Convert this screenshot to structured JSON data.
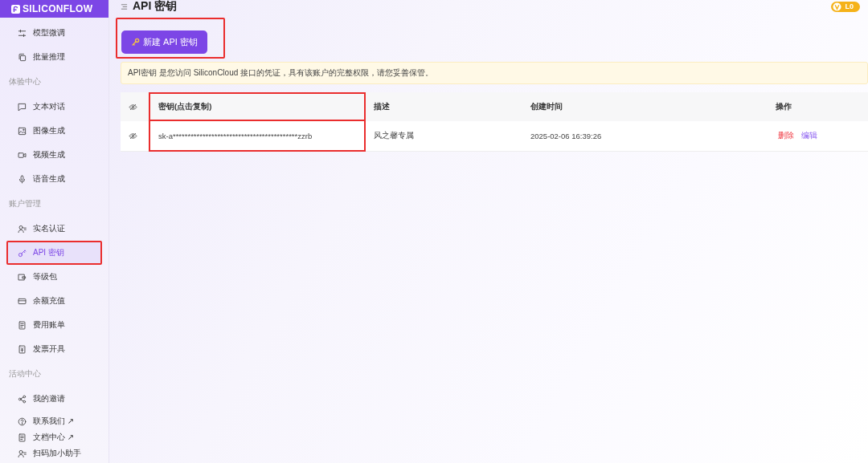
{
  "logo": {
    "text": "SILICONFLOW"
  },
  "sidebar": {
    "items": [
      {
        "kind": "item",
        "label": "模型微调",
        "selected": false,
        "annotated": false
      },
      {
        "kind": "item",
        "label": "批量推理",
        "selected": false,
        "annotated": false
      },
      {
        "kind": "section",
        "label": "体验中心"
      },
      {
        "kind": "item",
        "label": "文本对话",
        "selected": false,
        "annotated": false
      },
      {
        "kind": "item",
        "label": "图像生成",
        "selected": false,
        "annotated": false
      },
      {
        "kind": "item",
        "label": "视频生成",
        "selected": false,
        "annotated": false
      },
      {
        "kind": "item",
        "label": "语音生成",
        "selected": false,
        "annotated": false
      },
      {
        "kind": "section",
        "label": "账户管理"
      },
      {
        "kind": "item",
        "label": "实名认证",
        "selected": false,
        "annotated": false
      },
      {
        "kind": "item",
        "label": "API 密钥",
        "selected": true,
        "annotated": true
      },
      {
        "kind": "item",
        "label": "等级包",
        "selected": false,
        "annotated": false
      },
      {
        "kind": "item",
        "label": "余额充值",
        "selected": false,
        "annotated": false
      },
      {
        "kind": "item",
        "label": "费用账单",
        "selected": false,
        "annotated": false
      },
      {
        "kind": "item",
        "label": "发票开具",
        "selected": false,
        "annotated": false
      },
      {
        "kind": "section",
        "label": "活动中心"
      },
      {
        "kind": "item",
        "label": "我的邀请",
        "selected": false,
        "annotated": false
      }
    ],
    "footer": [
      {
        "label": "联系我们 ↗"
      },
      {
        "label": "文档中心 ↗"
      },
      {
        "label": "扫码加小助手"
      }
    ]
  },
  "header": {
    "title": "API 密钥",
    "badge": "L0"
  },
  "new_button": {
    "label": "新建 API 密钥",
    "annotated": true
  },
  "notice": "API密钥 是您访问 SiliconCloud 接口的凭证，具有该账户的完整权限，请您妥善保管。",
  "table": {
    "columns": [
      {
        "label": "密钥(点击复制)",
        "annotated": true
      },
      {
        "label": "描述"
      },
      {
        "label": "创建时间"
      },
      {
        "label": "操作"
      }
    ],
    "rows": [
      {
        "key": "sk-a******************************************zzrb",
        "description": "风之馨专属",
        "created": "2025-02-06 16:39:26",
        "actions": [
          {
            "kind": "danger",
            "label": "删除"
          },
          {
            "kind": "link",
            "label": "编辑"
          }
        ]
      }
    ]
  }
}
